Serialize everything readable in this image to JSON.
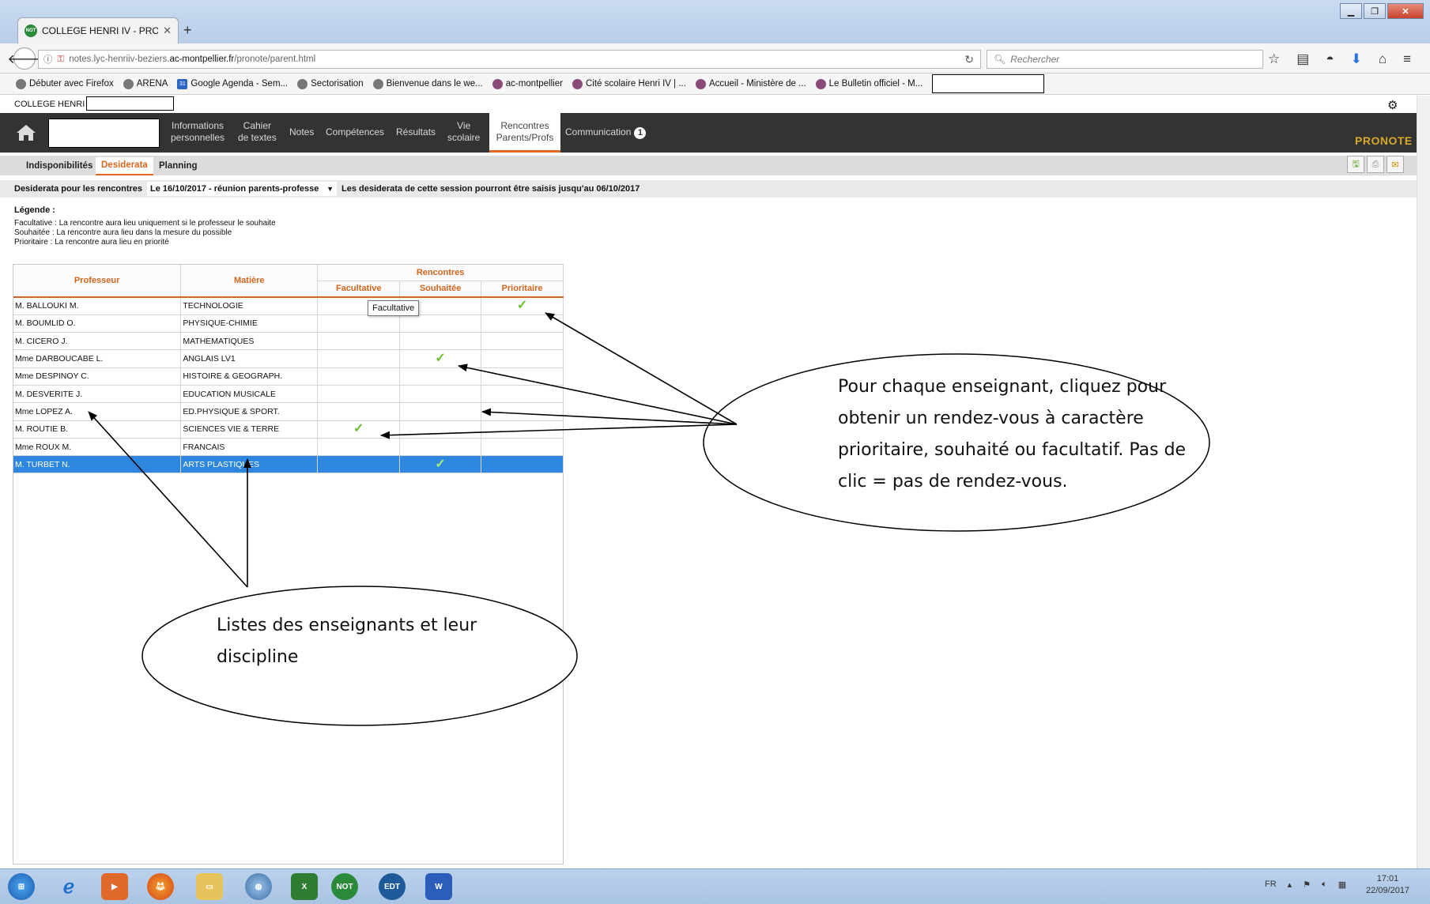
{
  "browser": {
    "tab_title": "COLLEGE HENRI IV - PRONO",
    "tab_favicon": "NOT",
    "url_prefix": "notes.lyc-henriiv-beziers.",
    "url_domain": "ac-montpellier.fr",
    "url_path": "/pronote/parent.html",
    "search_placeholder": "Rechercher",
    "bookmarks": [
      {
        "label": "Débuter avec Firefox",
        "icon": "globe-icon"
      },
      {
        "label": "ARENA",
        "icon": "globe-icon"
      },
      {
        "label": "Google Agenda - Sem...",
        "icon": "calendar-icon",
        "icon_text": "31"
      },
      {
        "label": "Sectorisation",
        "icon": "globe-icon"
      },
      {
        "label": "Bienvenue dans le we...",
        "icon": "globe-icon"
      },
      {
        "label": "ac-montpellier",
        "icon": "e-icon"
      },
      {
        "label": "Cité scolaire Henri IV | ...",
        "icon": "e-icon"
      },
      {
        "label": "Accueil - Ministère de ...",
        "icon": "e-icon"
      },
      {
        "label": "Le Bulletin officiel - M...",
        "icon": "e-icon"
      }
    ]
  },
  "app": {
    "school": "COLLEGE HENRI IV",
    "menu": [
      {
        "label1": "Informations",
        "label2": "personnelles"
      },
      {
        "label1": "Cahier",
        "label2": "de textes"
      },
      {
        "label1": "Notes",
        "label2": ""
      },
      {
        "label1": "Compétences",
        "label2": ""
      },
      {
        "label1": "Résultats",
        "label2": ""
      },
      {
        "label1": "Vie",
        "label2": "scolaire"
      }
    ],
    "menu_active": {
      "label1": "Rencontres",
      "label2": "Parents/Profs"
    },
    "menu_comm": "Communication",
    "comm_badge": "1",
    "logo": "PRONOTE",
    "subtabs": {
      "indisponibilites": "Indisponibilités",
      "desiderata": "Desiderata",
      "planning": "Planning"
    },
    "session_label": "Desiderata pour les rencontres",
    "session_value": "Le 16/10/2017 - réunion parents-professe",
    "session_note": "Les desiderata de cette session pourront être saisis jusqu'au 06/10/2017",
    "legend": {
      "title": "Légende :",
      "lines": [
        "Facultative : La rencontre aura lieu uniquement si le professeur le souhaite",
        "Souhaitée : La rencontre aura lieu dans la mesure du possible",
        "Prioritaire : La rencontre aura lieu en priorité"
      ]
    },
    "table": {
      "col_prof": "Professeur",
      "col_matiere": "Matière",
      "col_rencontres": "Rencontres",
      "col_fac": "Facultative",
      "col_sou": "Souhaitée",
      "col_pri": "Prioritaire",
      "check": "✓",
      "rows": [
        {
          "prof": "M. BALLOUKI M.",
          "matiere": "TECHNOLOGIE",
          "choice": "prioritaire"
        },
        {
          "prof": "M. BOUMLID O.",
          "matiere": "PHYSIQUE-CHIMIE",
          "choice": ""
        },
        {
          "prof": "M. CICERO J.",
          "matiere": "MATHEMATIQUES",
          "choice": ""
        },
        {
          "prof": "Mme DARBOUCABE L.",
          "matiere": "ANGLAIS LV1",
          "choice": "souhaitee"
        },
        {
          "prof": "Mme DESPINOY C.",
          "matiere": "HISTOIRE & GEOGRAPH.",
          "choice": ""
        },
        {
          "prof": "M. DESVERITE J.",
          "matiere": "EDUCATION MUSICALE",
          "choice": ""
        },
        {
          "prof": "Mme LOPEZ A.",
          "matiere": "ED.PHYSIQUE & SPORT.",
          "choice": ""
        },
        {
          "prof": "M. ROUTIE B.",
          "matiere": "SCIENCES VIE & TERRE",
          "choice": "facultative"
        },
        {
          "prof": "Mme ROUX M.",
          "matiere": "FRANCAIS",
          "choice": ""
        },
        {
          "prof": "M. TURBET N.",
          "matiere": "ARTS PLASTIQUES",
          "choice": "souhaitee",
          "selected": true
        }
      ]
    },
    "tooltip": "Facultative"
  },
  "annotations": {
    "right_lines": [
      "Pour chaque enseignant, cliquez pour",
      "obtenir un rendez-vous à caractère",
      "prioritaire, souhaité ou facultatif. Pas de",
      "clic = pas de rendez-vous."
    ],
    "left_lines": [
      "Listes des enseignants et leur",
      "discipline"
    ]
  },
  "taskbar": {
    "lang": "FR",
    "time": "17:01",
    "date": "22/09/2017"
  },
  "colors": {
    "accent": "#e0651e",
    "selection": "#2e86de",
    "check": "#6bbf2a",
    "menubar": "#333333"
  }
}
